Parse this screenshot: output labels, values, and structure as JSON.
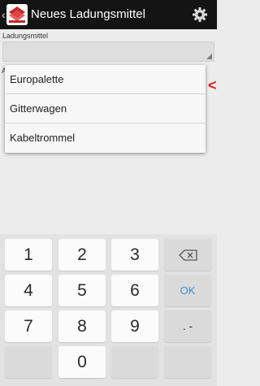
{
  "header": {
    "title": "Neues Ladungsmittel",
    "back_icon": "chevron-left-icon",
    "logo_icon": "app-logo-icon",
    "settings_icon": "gear-icon"
  },
  "form": {
    "field_label": "Ladungsmittel",
    "under_label_fragment": "A",
    "right_fragment": "<"
  },
  "dropdown": {
    "options": [
      "Europalette",
      "Gitterwagen",
      "Kabeltrommel"
    ]
  },
  "keyboard": {
    "rows": [
      [
        "1",
        "2",
        "3"
      ],
      [
        "4",
        "5",
        "6"
      ],
      [
        "7",
        "8",
        "9"
      ],
      [
        "",
        "0",
        ""
      ]
    ],
    "ok_label": "OK",
    "dot_dash_label": ". -",
    "backspace_icon": "backspace-icon"
  },
  "colors": {
    "action_bar": "#141414",
    "accent_ok": "#3b8fd6",
    "logo_red": "#c62828"
  }
}
